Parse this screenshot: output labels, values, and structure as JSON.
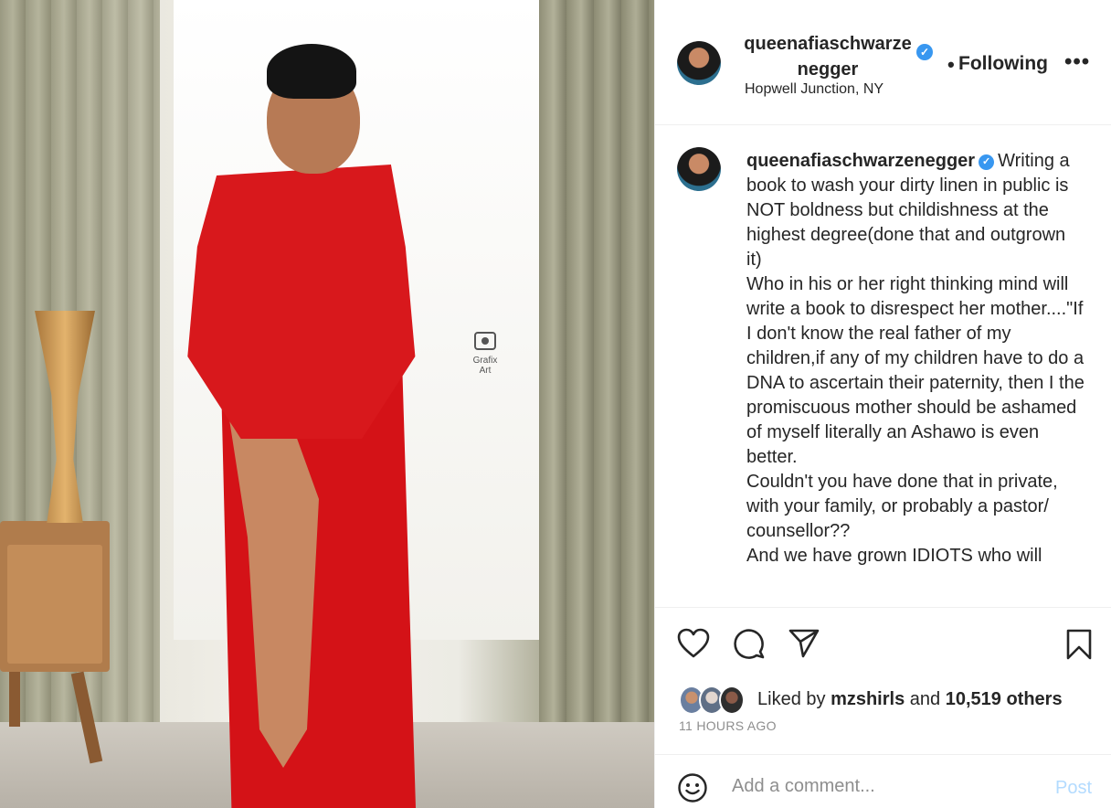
{
  "header": {
    "username": "queenafiaschwarze\nnegger",
    "verified_icon": "verified-badge-icon",
    "separator": "•",
    "follow_label": "Following",
    "more_label": "•••",
    "location": "Hopwell Junction, NY"
  },
  "media": {
    "watermark": "Grafix Art"
  },
  "caption": {
    "username": "queenafiaschwarzenegger",
    "text": "Writing a book to wash your dirty linen in public is NOT boldness but childishness at the highest degree(done that and outgrown it)\nWho in his or her right thinking mind will write a book to disrespect her mother....\"If I don't know the real father of my children,if any of my children have to do a DNA to ascertain their paternity, then I the promiscuous mother should be ashamed of myself literally an Ashawo is even better.\nCouldn't you have done that in private, with your family, or probably a pastor/ counsellor??\nAnd we have grown IDIOTS who will"
  },
  "actions": {
    "like_icon": "heart-icon",
    "comment_icon": "comment-bubble-icon",
    "share_icon": "paper-plane-icon",
    "save_icon": "bookmark-icon"
  },
  "likes": {
    "prefix": "Liked by",
    "first_user": "mzshirls",
    "joiner": "and",
    "others": "10,519 others"
  },
  "timestamp": "11 HOURS AGO",
  "comment": {
    "placeholder": "Add a comment...",
    "post_label": "Post",
    "emoji_icon": "smiley-icon"
  },
  "colors": {
    "verified": "#3897f0",
    "text": "#262626",
    "muted": "#8e8e8e",
    "post_disabled": "#b3dbff",
    "dress": "#d41217"
  }
}
